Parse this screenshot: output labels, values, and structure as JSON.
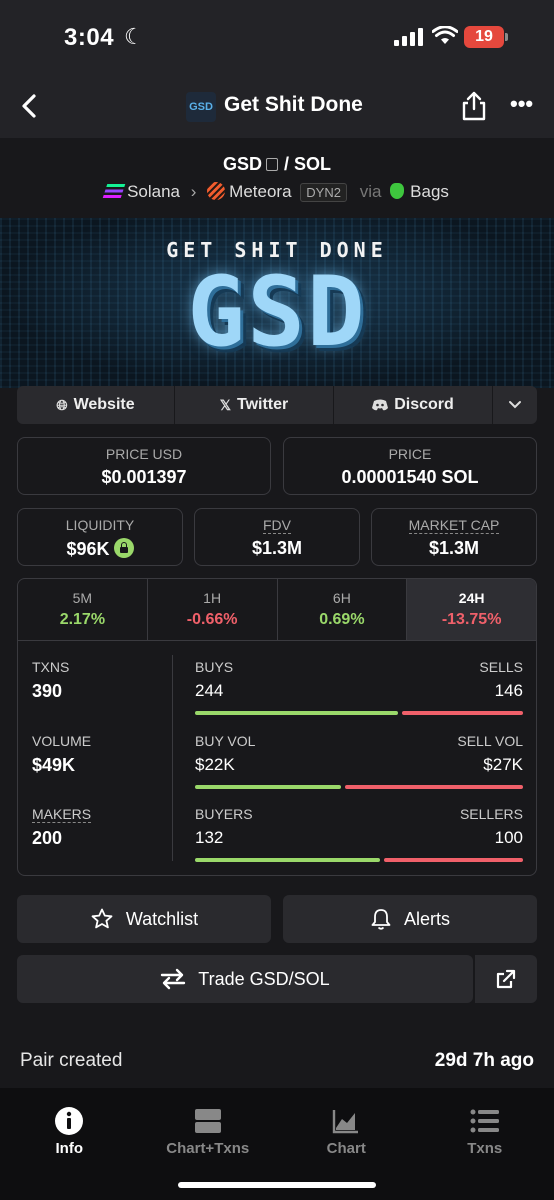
{
  "status": {
    "time": "3:04",
    "battery": "19"
  },
  "nav": {
    "logo_text": "GSD",
    "title": "Get Shit Done"
  },
  "pair": {
    "base": "GSD",
    "separator": "/",
    "quote": "SOL",
    "chain": "Solana",
    "dex": "Meteora",
    "dex_badge": "DYN2",
    "via": "via",
    "launchpad": "Bags"
  },
  "banner": {
    "top_text": "GET SHIT DONE",
    "big_text": "GSD"
  },
  "links": [
    {
      "label": "Website",
      "icon": "globe-icon"
    },
    {
      "label": "Twitter",
      "icon": "x-icon"
    },
    {
      "label": "Discord",
      "icon": "discord-icon"
    }
  ],
  "prices": {
    "usd_label": "PRICE USD",
    "usd_value": "$0.001397",
    "native_label": "PRICE",
    "native_value": "0.00001540 SOL"
  },
  "metrics": {
    "liquidity_label": "LIQUIDITY",
    "liquidity_value": "$96K",
    "fdv_label": "FDV",
    "fdv_value": "$1.3M",
    "mcap_label": "MARKET CAP",
    "mcap_value": "$1.3M"
  },
  "timeframes": [
    {
      "label": "5M",
      "change": "2.17%"
    },
    {
      "label": "1H",
      "change": "-0.66%"
    },
    {
      "label": "6H",
      "change": "0.69%"
    },
    {
      "label": "24H",
      "change": "-13.75%"
    }
  ],
  "stats": {
    "txns_label": "TXNS",
    "txns_value": "390",
    "volume_label": "VOLUME",
    "volume_value": "$49K",
    "makers_label": "MAKERS",
    "makers_value": "200",
    "buys_label": "BUYS",
    "buys_value": "244",
    "sells_label": "SELLS",
    "sells_value": "146",
    "buyvol_label": "BUY VOL",
    "buyvol_value": "$22K",
    "sellvol_label": "SELL VOL",
    "sellvol_value": "$27K",
    "buyers_label": "BUYERS",
    "buyers_value": "132",
    "sellers_label": "SELLERS",
    "sellers_value": "100",
    "buys_share": 0.626,
    "buyvol_share": 0.45,
    "buyers_share": 0.57
  },
  "actions": {
    "watchlist": "Watchlist",
    "alerts": "Alerts",
    "trade": "Trade GSD/SOL"
  },
  "info": {
    "pair_created_label": "Pair created",
    "pair_created_value": "29d 7h ago"
  },
  "tabs": [
    {
      "label": "Info",
      "icon": "info-icon"
    },
    {
      "label": "Chart+Txns",
      "icon": "chart-txns-icon"
    },
    {
      "label": "Chart",
      "icon": "chart-icon"
    },
    {
      "label": "Txns",
      "icon": "txns-icon"
    }
  ],
  "colors": {
    "buy": "#9ad86a",
    "sell": "#f0606a",
    "background": "#18181b",
    "panel": "#2a2a2e"
  }
}
